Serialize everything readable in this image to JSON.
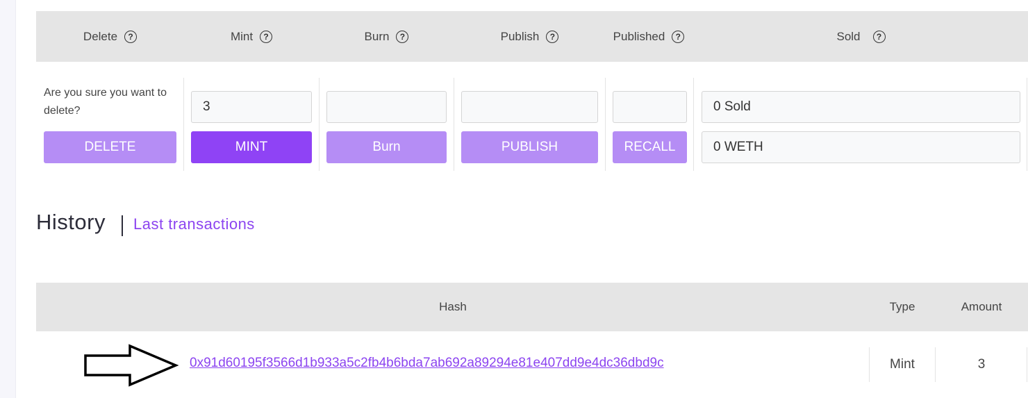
{
  "actions": {
    "headers": {
      "delete": "Delete",
      "mint": "Mint",
      "burn": "Burn",
      "publish": "Publish",
      "published": "Published",
      "sold": "Sold"
    },
    "help_glyph": "?",
    "delete_confirm_text": "Are you sure you want to delete?",
    "delete_button": "DELETE",
    "mint_value": "3",
    "mint_button": "MINT",
    "burn_value": "",
    "burn_button": "Burn",
    "publish_value": "",
    "publish_button": "PUBLISH",
    "published_value": "",
    "recall_button": "RECALL",
    "sold_count": "0 Sold",
    "sold_amount": "0 WETH"
  },
  "history": {
    "title": "History",
    "subtitle": "Last transactions",
    "columns": {
      "hash": "Hash",
      "type": "Type",
      "amount": "Amount"
    },
    "rows": [
      {
        "hash": "0x91d60195f3566d1b933a5c2fb4b6bda7ab692a89294e81e407dd9e4dc36dbd9c",
        "type": "Mint",
        "amount": "3"
      }
    ]
  },
  "colors": {
    "accent": "#8f43f5",
    "accent_light": "#b58df5",
    "link": "#8c44f0",
    "header_bg": "#e5e5e5"
  },
  "icons": {
    "help": "help-circle-icon",
    "annotation_arrow": "arrow-right-icon"
  }
}
